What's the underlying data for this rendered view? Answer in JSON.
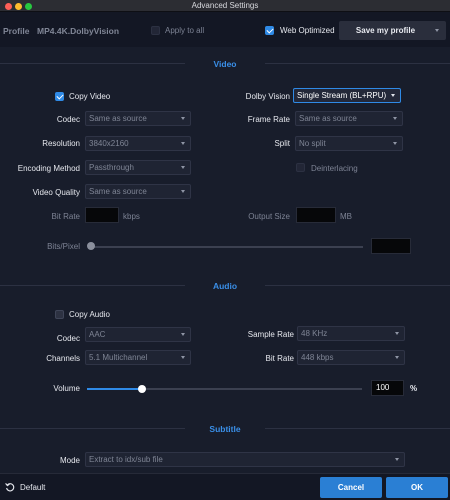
{
  "window": {
    "title": "Advanced Settings"
  },
  "header": {
    "profile_label": "Profile",
    "profile_value": "MP4.4K.DolbyVision",
    "apply_to_all": {
      "label": "Apply to all",
      "checked": false
    },
    "web_optimized": {
      "label": "Web Optimized",
      "checked": true
    },
    "save_profile_label": "Save my profile"
  },
  "video": {
    "section_title": "Video",
    "copy_video": {
      "label": "Copy Video",
      "checked": true
    },
    "dolby_vision": {
      "label": "Dolby Vision",
      "value": "Single Stream (BL+RPU)"
    },
    "codec": {
      "label": "Codec",
      "value": "Same as source"
    },
    "frame_rate": {
      "label": "Frame Rate",
      "value": "Same as source"
    },
    "resolution": {
      "label": "Resolution",
      "value": "3840x2160"
    },
    "split": {
      "label": "Split",
      "value": "No split"
    },
    "encoding_method": {
      "label": "Encoding Method",
      "value": "Passthrough"
    },
    "deinterlacing": {
      "label": "Deinterlacing",
      "checked": false
    },
    "video_quality": {
      "label": "Video Quality",
      "value": "Same as source"
    },
    "bit_rate": {
      "label": "Bit Rate",
      "value": "",
      "unit": "kbps"
    },
    "output_size": {
      "label": "Output Size",
      "value": "",
      "unit": "MB"
    },
    "bits_per_pixel": {
      "label": "Bits/Pixel",
      "value": "",
      "slider_fraction": 0.0
    }
  },
  "audio": {
    "section_title": "Audio",
    "copy_audio": {
      "label": "Copy Audio",
      "checked": false
    },
    "codec": {
      "label": "Codec",
      "value": "AAC"
    },
    "sample_rate": {
      "label": "Sample Rate",
      "value": "48 KHz"
    },
    "channels": {
      "label": "Channels",
      "value": "5.1 Multichannel"
    },
    "bit_rate": {
      "label": "Bit Rate",
      "value": "448 kbps"
    },
    "volume": {
      "label": "Volume",
      "value": "100",
      "unit": "%",
      "slider_fraction": 0.2
    }
  },
  "subtitle": {
    "section_title": "Subtitle",
    "mode": {
      "label": "Mode",
      "value": "Extract to idx/sub file"
    }
  },
  "footer": {
    "default_label": "Default",
    "cancel_label": "Cancel",
    "ok_label": "OK"
  },
  "colors": {
    "accent": "#2f8ae6",
    "background": "#181d2b"
  },
  "icons": {
    "default": "reset-icon"
  }
}
